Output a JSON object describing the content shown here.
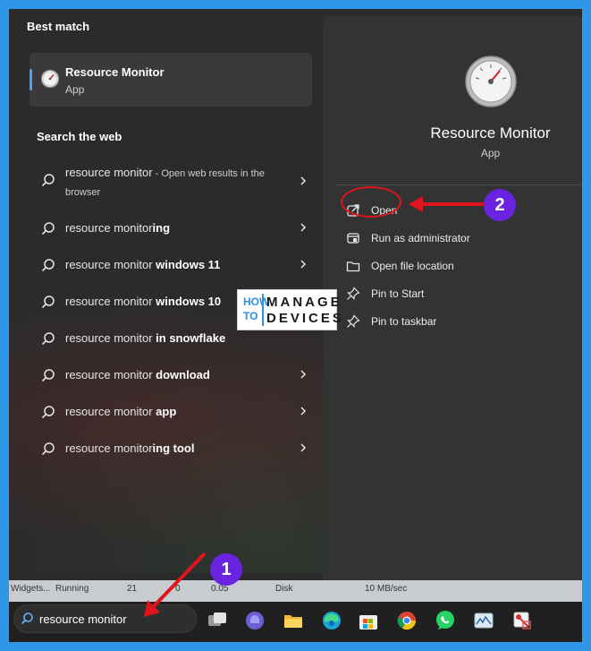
{
  "best_match": {
    "header": "Best match",
    "app_name": "Resource Monitor",
    "app_type": "App"
  },
  "web": {
    "header": "Search the web",
    "items": [
      {
        "prefix": "resource monitor",
        "bold": "",
        "note": " - Open web results in the browser"
      },
      {
        "prefix": "resource monitor",
        "bold": "ing",
        "note": ""
      },
      {
        "prefix": "resource monitor",
        "bold": " windows 11",
        "note": ""
      },
      {
        "prefix": "resource monitor",
        "bold": " windows 10",
        "note": ""
      },
      {
        "prefix": "resource monitor",
        "bold": " in snowflake",
        "note": ""
      },
      {
        "prefix": "resource monitor",
        "bold": " download",
        "note": ""
      },
      {
        "prefix": "resource monitor",
        "bold": " app",
        "note": ""
      },
      {
        "prefix": "resource monitor",
        "bold": "ing tool",
        "note": ""
      }
    ]
  },
  "details": {
    "title": "Resource Monitor",
    "subtitle": "App",
    "actions": [
      {
        "label": "Open",
        "icon": "open-external-icon"
      },
      {
        "label": "Run as administrator",
        "icon": "shield-admin-icon"
      },
      {
        "label": "Open file location",
        "icon": "folder-icon"
      },
      {
        "label": "Pin to Start",
        "icon": "pin-icon"
      },
      {
        "label": "Pin to taskbar",
        "icon": "pin-icon"
      }
    ]
  },
  "annotations": {
    "step1": "1",
    "step2": "2",
    "accent_color": "#e0141c",
    "badge_color": "#6a23e0"
  },
  "watermark": {
    "line1a": "HOW",
    "line1b": "MANAGE",
    "line2a": "TO",
    "line2b": "DEVICES"
  },
  "background_strip": {
    "t1": "Widgets...",
    "t2": "Running",
    "t3": "21",
    "t4": "0",
    "t5": "0.05",
    "t6": "Disk",
    "t7": "10 MB/sec"
  },
  "taskbar": {
    "search_value": "resource monitor",
    "icons": [
      "task-view-icon",
      "teams-icon",
      "file-explorer-icon",
      "edge-icon",
      "store-icon",
      "chrome-icon",
      "whatsapp-icon",
      "photos-icon",
      "snipping-tool-icon"
    ]
  },
  "colors": {
    "page_border": "#2f97e8",
    "panel_bg": "#2b2b2b",
    "detail_bg": "#333333",
    "selection_accent": "#4ea1f0"
  }
}
